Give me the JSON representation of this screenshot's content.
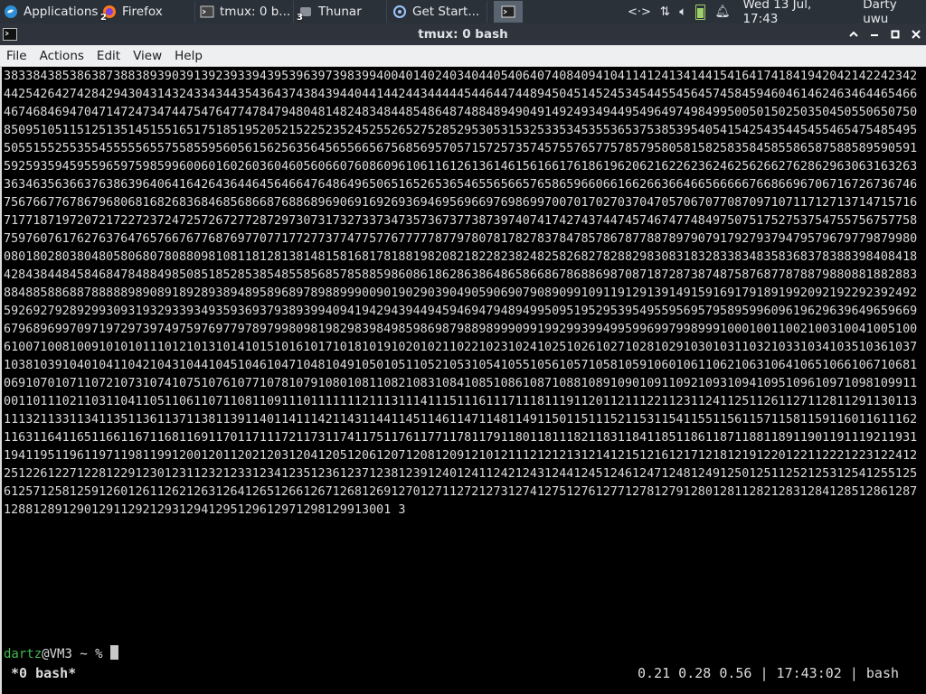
{
  "panel": {
    "apps_label": "Applications",
    "tasks": [
      {
        "label": "Firefox",
        "badge": "2"
      },
      {
        "label": "tmux: 0 b...",
        "badge": ""
      },
      {
        "label": "Thunar",
        "badge": "3"
      },
      {
        "label": "Get Start...",
        "badge": ""
      }
    ],
    "clock": "Wed 13 Jul, 17:43",
    "user": "Darty uwu"
  },
  "window": {
    "title": "tmux: 0 bash"
  },
  "menu": [
    "File",
    "Actions",
    "Edit",
    "View",
    "Help"
  ],
  "terminal": {
    "output": "38338438538638738838939039139239339439539639739839940040140240340440540640740840941041141241341441541641741841942042142242342442542642742842943043143243343443543643743843944044144244344444544644744894504514524534544554564574584594604614624634644654664674684694704714724734744754764774784794804814824834844854864874884894904914924934944954964974984995005015025035045055065075085095105115125135145155165175185195205215225235245255265275285295305315325335345355365375385395405415425435445455465475485495505515525535545555565575585595605615625635645655665675685695705715725735745755765775785795805815825835845855865875885895905915925935945955965975985996006016026036046056066076086096106116126136146156166176186196206216226236246256266276286296306316326336346356366376386396406416426436446456466476486496506516526536546556566576586596606616626636646656666676686696706716726736746756766776786796806816826836846856866876886896906916926936946956966976986997007017027037047057067077087097107117127137147157167177187197207217227237247257267277287297307317327337347357367377387397407417427437447457467477484975075175275375475575675775875976076176276376476576676776876977077177277377477577677777877978078178278378478578678778878979079179279379479579679779879980080180280380480580680780880981081181281381481581681781881982082182282382482582682782882983083183283383483583683783883984084184284384484584684784884985085185285385485585685785885986086186286386486586686786886987087187287387487587687787887988088188288388488588688788888989089189289389489589689789889990090190290390490590690790890991091191291391491591691791891992092192292392492592692792892993093193293393493593693793893994094194294394494594694794894995095195295395495595695795895996096196296396496596696796896997097197297397497597697797897998098198298398498598698798898999099199299399499599699799899910001001100210031004100510061007100810091010101110121013101410151016101710181019102010211022102310241025102610271028102910301031103210331034103510361037103810391040104110421043104410451046104710481049105010511052105310541055105610571058105910601061106210631064106510661067106810691070107110721073107410751076107710781079108010811082108310841085108610871088108910901091109210931094109510961097109810991100110111021103110411051106110711081109111011111112111311141115111611171118111911201121112211231124112511261127112811291130113111321133113411351136113711381139114011411142114311441145114611471148114911501151115211531154115511561157115811591160116111621163116411651166116711681169117011711172117311741175117611771178117911801181118211831184118511861187118811891190119111921193119411951196119711981199120012011202120312041205120612071208120912101211121212131214121512161217121812191220122112221223122412251226122712281229123012311232123312341235123612371238123912401241124212431244124512461247124812491250125112521253125412551256125712581259126012611262126312641265126612671268126912701271127212731274127512761277127812791280128112821283128412851286128712881289129012911292129312941295129612971298129913001 3",
    "prompt_user": "dartz",
    "prompt_host": "@VM3 ~ % "
  },
  "tmux": {
    "window_label": "*0 bash*",
    "status_right": "0.21 0.28 0.56 | 17:43:02 | bash"
  },
  "colors": {
    "panel_bg": "#2b3139",
    "title_bg": "#2f343c",
    "menu_bg": "#edeff1",
    "prompt_user": "#3fb950"
  }
}
